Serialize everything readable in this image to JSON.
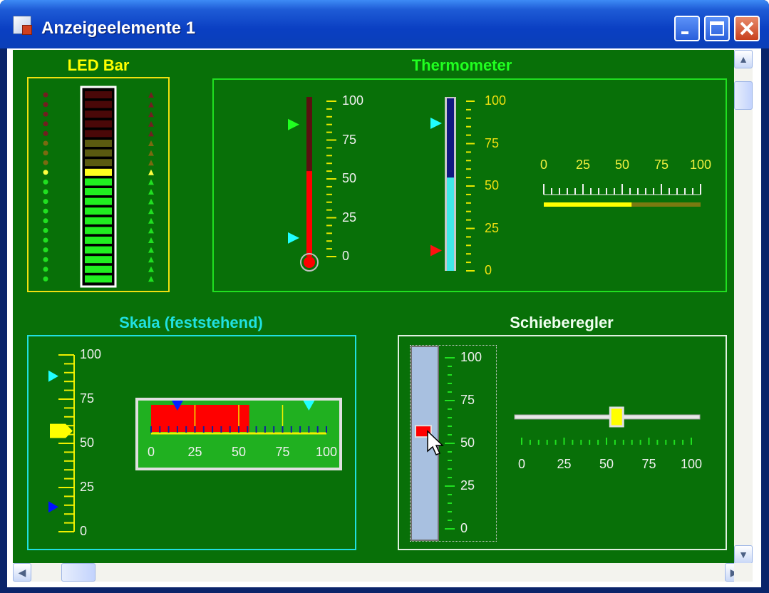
{
  "window": {
    "title": "Anzeigeelemente 1",
    "buttons": [
      "minimize",
      "maximize",
      "close"
    ]
  },
  "colors": {
    "background": "#087008",
    "led_frame": "#f0e010",
    "thermo_frame": "#20e020",
    "scale_frame": "#20e0e0",
    "slider_frame": "#e0f0e0",
    "yellow": "#ffff00",
    "red": "#ff0000",
    "cyan": "#00ffff",
    "blue": "#0000ff"
  },
  "led_bar": {
    "title": "LED Bar",
    "level": 12,
    "total": 20
  },
  "thermometer": {
    "title": "Thermometer",
    "scale_labels": [
      "100",
      "75",
      "50",
      "25",
      "0"
    ],
    "h_scale_labels": [
      "0",
      "25",
      "50",
      "75",
      "100"
    ],
    "red_thermometer_value": 55,
    "red_thermo_markers": [
      85,
      12
    ],
    "blue_thermometer_value": 55,
    "blue_thermo_markers": [
      87,
      12
    ],
    "horizontal_bar_value": 56
  },
  "scale_fixed": {
    "title": "Skala (feststehend)",
    "scale_labels": [
      "100",
      "75",
      "50",
      "25",
      "0"
    ],
    "h_scale_labels": [
      "0",
      "25",
      "50",
      "75",
      "100"
    ],
    "vertical_pointer_value": 57,
    "vertical_markers": [
      88,
      14
    ],
    "horizontal_value": 56,
    "horizontal_markers": [
      15,
      90
    ]
  },
  "slider": {
    "title": "Schieberegler",
    "scale_labels": [
      "100",
      "75",
      "50",
      "25",
      "0"
    ],
    "h_scale_labels": [
      "0",
      "25",
      "50",
      "75",
      "100"
    ],
    "vertical_value": 57,
    "horizontal_value": 56
  },
  "icons": [
    "app-icon",
    "minimize-icon",
    "maximize-icon",
    "close-icon",
    "scroll-up-icon",
    "scroll-down-icon",
    "scroll-left-icon",
    "scroll-right-icon",
    "mouse-cursor-icon"
  ]
}
